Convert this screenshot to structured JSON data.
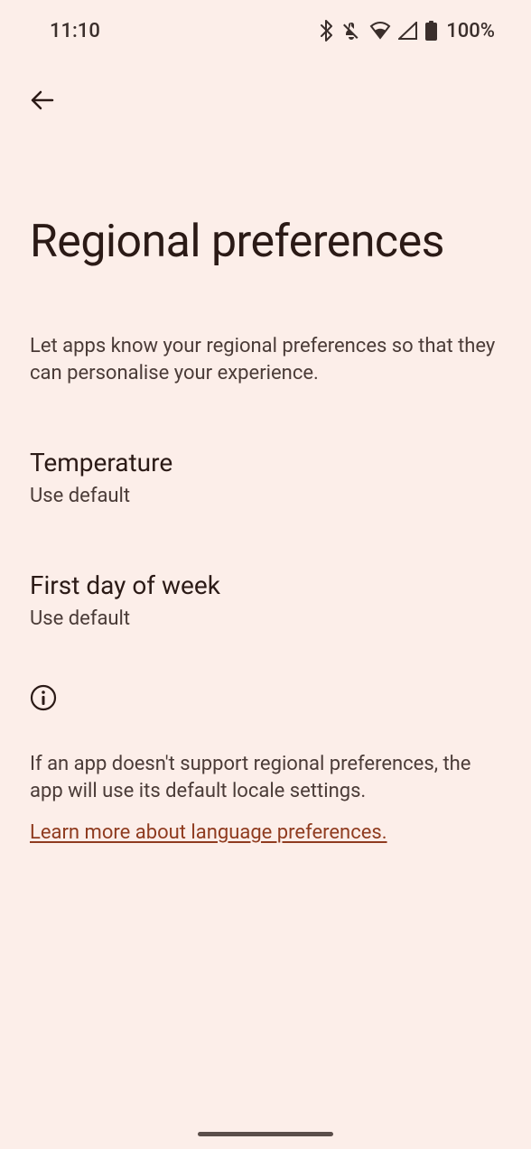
{
  "statusBar": {
    "time": "11:10",
    "batteryPercent": "100%"
  },
  "page": {
    "title": "Regional preferences",
    "description": "Let apps know your regional preferences so that they can personalise your experience."
  },
  "settings": {
    "temperature": {
      "label": "Temperature",
      "value": "Use default"
    },
    "firstDayOfWeek": {
      "label": "First day of week",
      "value": "Use default"
    }
  },
  "info": {
    "text": "If an app doesn't support regional preferences, the app will use its default locale settings.",
    "link": "Learn more about language preferences."
  }
}
